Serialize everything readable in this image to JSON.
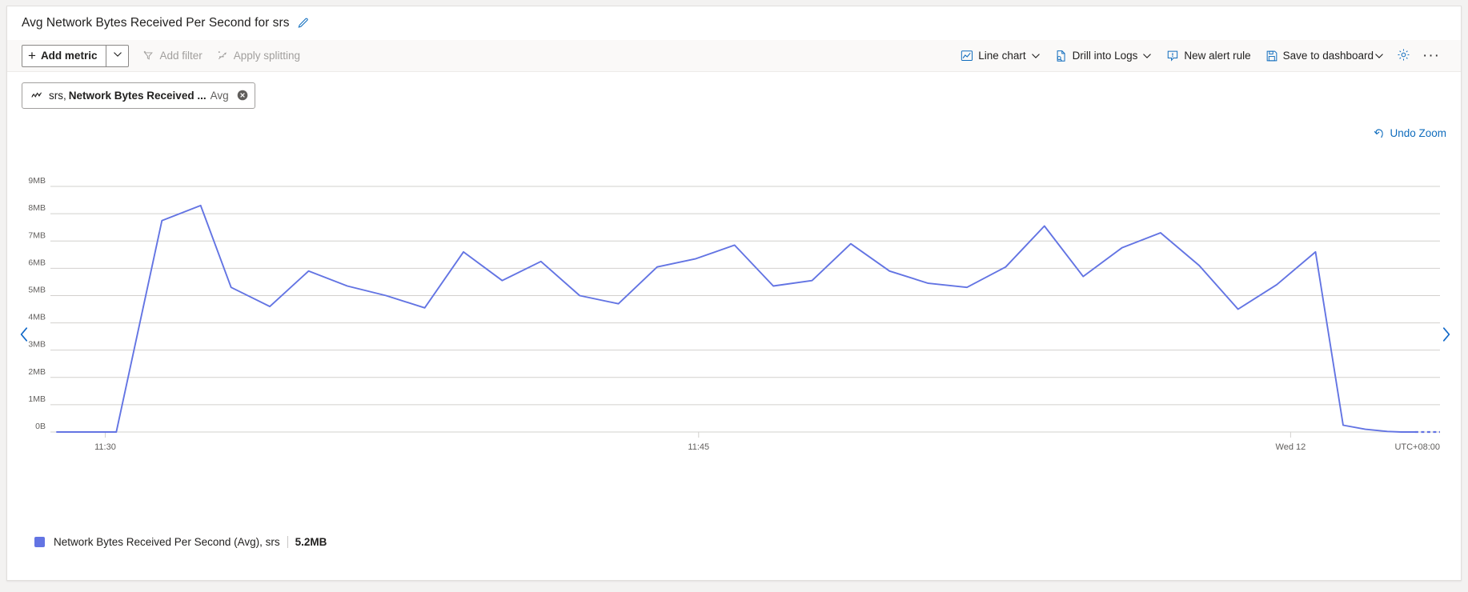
{
  "header": {
    "title": "Avg Network Bytes Received Per Second for srs",
    "edit_icon": "pencil-icon"
  },
  "toolbar": {
    "add_metric_label": "Add metric",
    "add_metric_plus": "+",
    "add_metric_caret_icon": "chevron-down-icon",
    "add_filter_label": "Add filter",
    "add_filter_icon": "add-filter-icon",
    "apply_splitting_label": "Apply splitting",
    "apply_splitting_icon": "apply-splitting-icon",
    "chart_type_label": "Line chart",
    "chart_type_icon": "line-chart-icon",
    "drill_logs_label": "Drill into Logs",
    "drill_logs_icon": "drill-logs-icon",
    "new_alert_label": "New alert rule",
    "new_alert_icon": "alert-bell-icon",
    "save_dashboard_label": "Save to dashboard",
    "save_dashboard_icon": "save-disk-icon",
    "settings_icon": "gear-icon",
    "more_label": "···",
    "more_icon": "ellipsis-icon"
  },
  "metric_chip": {
    "icon": "metric-scatter-icon",
    "resource": "srs,",
    "metric": "Network Bytes Received ...",
    "aggregation": "Avg",
    "close_icon": "close-circle-icon"
  },
  "undo_zoom": {
    "label": "Undo Zoom",
    "icon": "undo-arrow-icon"
  },
  "nav": {
    "prev_icon": "chevron-left-icon",
    "next_icon": "chevron-right-icon"
  },
  "legend": {
    "swatch_color": "#6374e3",
    "label": "Network Bytes Received Per Second (Avg), srs",
    "value": "5.2MB"
  },
  "colors": {
    "accent": "#0f6cbd",
    "series": "#6374e3",
    "grid": "#d2d0ce",
    "axis_text": "#605e5c",
    "panel_bg": "#ffffff",
    "cmdbar_bg": "#faf9f8"
  },
  "chart_data": {
    "type": "line",
    "title": "Avg Network Bytes Received Per Second for srs",
    "xlabel": "",
    "ylabel": "",
    "grid": true,
    "legend_position": "bottom-left",
    "timezone_label": "UTC+08:00",
    "y_unit": "MB",
    "ylim": [
      0,
      9.5
    ],
    "ytick_labels": [
      "0B",
      "1MB",
      "2MB",
      "3MB",
      "4MB",
      "5MB",
      "6MB",
      "7MB",
      "8MB",
      "9MB"
    ],
    "ytick_values": [
      0,
      1,
      2,
      3,
      4,
      5,
      6,
      7,
      8,
      9
    ],
    "xtick_labels": [
      "11:30",
      "11:45",
      "Wed 12"
    ],
    "xtick_positions": [
      0.035,
      0.464,
      0.892
    ],
    "series": [
      {
        "name": "Network Bytes Received Per Second (Avg), srs",
        "color": "#6374e3",
        "dashed_tail_from_index": 39,
        "x": [
          0.0,
          0.016,
          0.032,
          0.043,
          0.076,
          0.104,
          0.126,
          0.154,
          0.182,
          0.21,
          0.238,
          0.266,
          0.294,
          0.322,
          0.35,
          0.378,
          0.406,
          0.434,
          0.462,
          0.49,
          0.518,
          0.546,
          0.574,
          0.602,
          0.63,
          0.658,
          0.686,
          0.714,
          0.742,
          0.77,
          0.798,
          0.826,
          0.854,
          0.882,
          0.91,
          0.93,
          0.946,
          0.962,
          0.972,
          0.982,
          0.994,
          1.0
        ],
        "values": [
          0.0,
          0.0,
          0.0,
          0.0,
          7.75,
          8.3,
          5.3,
          4.6,
          5.9,
          5.35,
          5.0,
          4.55,
          6.6,
          5.55,
          6.25,
          5.0,
          4.7,
          6.05,
          6.35,
          6.85,
          5.35,
          5.55,
          6.9,
          5.9,
          5.45,
          5.3,
          6.05,
          7.55,
          5.7,
          6.75,
          7.3,
          6.1,
          4.5,
          5.4,
          6.6,
          0.25,
          0.1,
          0.02,
          0.0,
          0.0,
          0.0,
          0.0
        ]
      }
    ]
  }
}
